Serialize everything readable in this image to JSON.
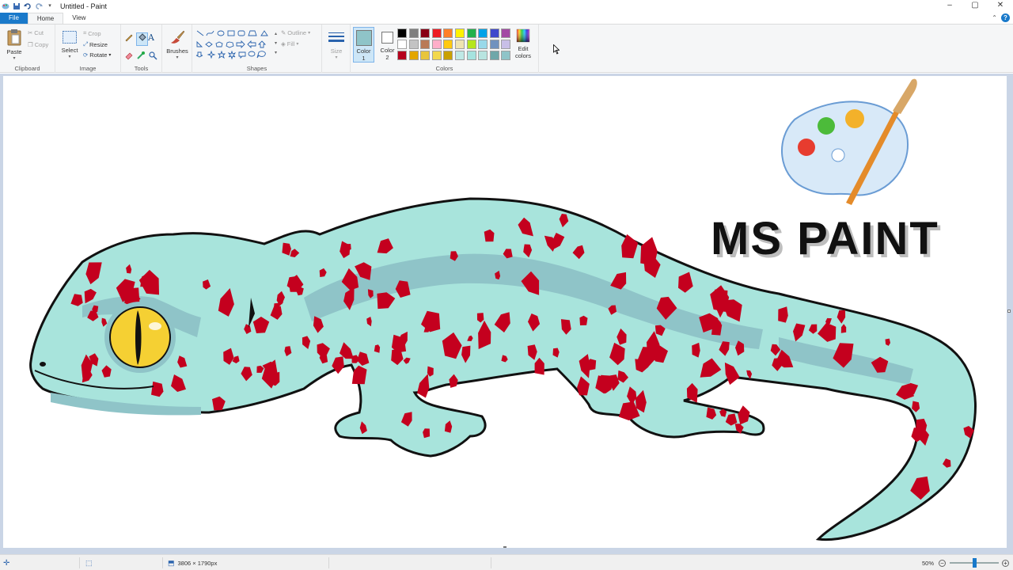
{
  "window": {
    "title": "Untitled - Paint"
  },
  "quick_access": [
    "save-icon",
    "undo-icon",
    "redo-icon",
    "customize-icon"
  ],
  "window_buttons": {
    "minimize": "–",
    "maximize": "▢",
    "close": "✕"
  },
  "tabs": [
    {
      "label": "File"
    },
    {
      "label": "Home"
    },
    {
      "label": "View"
    }
  ],
  "help_label": "?",
  "ribbon": {
    "clipboard": {
      "group_label": "Clipboard",
      "paste": "Paste",
      "cut": "Cut",
      "copy": "Copy"
    },
    "image": {
      "group_label": "Image",
      "select": "Select",
      "crop": "Crop",
      "resize": "Resize",
      "rotate": "Rotate"
    },
    "tools": {
      "group_label": "Tools",
      "text_tool": "A"
    },
    "brushes": {
      "label": "Brushes"
    },
    "shapes": {
      "group_label": "Shapes",
      "outline": "Outline",
      "fill": "Fill"
    },
    "size": {
      "label": "Size"
    },
    "colors": {
      "group_label": "Colors",
      "color1_label": "Color",
      "color1_num": "1",
      "color2_label": "Color",
      "color2_num": "2",
      "color1_value": "#8fc4c8",
      "color2_value": "#ffffff",
      "edit_label": "Edit",
      "edit_label2": "colors",
      "palette_row1": [
        "#000000",
        "#7f7f7f",
        "#880015",
        "#ed1c24",
        "#ff7f27",
        "#fff200",
        "#22b14c",
        "#00a2e8",
        "#3f48cc",
        "#a349a4"
      ],
      "palette_row2": [
        "#ffffff",
        "#c3c3c3",
        "#b97a57",
        "#ffaec9",
        "#ffc90e",
        "#efe4b0",
        "#b5e61d",
        "#99d9ea",
        "#7092be",
        "#c8bfe7"
      ],
      "palette_row3": [
        "#b5001d",
        "#e3a600",
        "#e8c53c",
        "#f2d84c",
        "#c9a100",
        "#bfe9e6",
        "#a6e3df",
        "#b8e4e0",
        "#6fa7a9",
        "#8fc4c8"
      ]
    }
  },
  "canvas": {
    "overlay_text": "MS PAINT",
    "colors": {
      "skin": "#a8e4dc",
      "shade": "#8fc4c8",
      "spot": "#c4001e",
      "outline": "#111111",
      "eye": "#f5d033"
    }
  },
  "statusbar": {
    "dimensions": "3806 × 1790px",
    "zoom": "50%",
    "zoom_level": 0.5
  }
}
